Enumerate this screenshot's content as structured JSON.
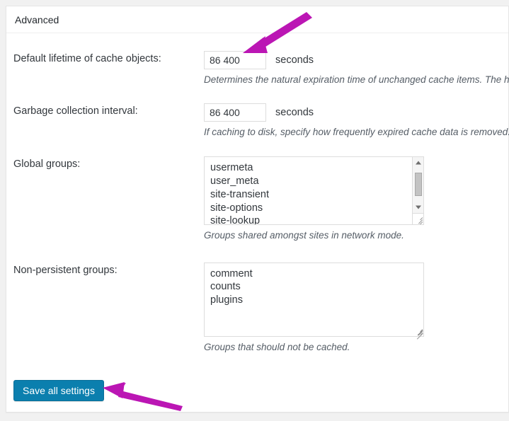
{
  "card": {
    "header_title": "Advanced"
  },
  "fields": {
    "lifetime": {
      "label": "Default lifetime of cache objects:",
      "value": "86 400",
      "placeholder": "",
      "unit": "seconds",
      "description": "Determines the natural expiration time of unchanged cache items. The high"
    },
    "gc_interval": {
      "label": "Garbage collection interval:",
      "value": "86 400",
      "placeholder": "",
      "unit": "seconds",
      "description": "If caching to disk, specify how frequently expired cache data is removed. For"
    },
    "global_groups": {
      "label": "Global groups:",
      "value": "usermeta\nuser_meta\nsite-transient\nsite-options\nsite-lookup\nblog-lookup",
      "visible_lines": [
        "usermeta",
        "user_meta",
        "site-transient",
        "site-options",
        "site-lookup"
      ],
      "description": "Groups shared amongst sites in network mode."
    },
    "nonpersistent_groups": {
      "label": "Non-persistent groups:",
      "value": "comment\ncounts\nplugins",
      "visible_lines": [
        "comment",
        "counts",
        "plugins"
      ],
      "description": "Groups that should not be cached."
    }
  },
  "submit": {
    "save_label": "Save all settings"
  },
  "annotations": {
    "arrow_to_lifetime_input": "magenta-arrow-pointing-down-left-at-cache-lifetime-field",
    "arrow_to_save_button": "magenta-arrow-pointing-left-at-save-all-settings-button"
  },
  "colors": {
    "page_background": "#f1f1f1",
    "card_background": "#ffffff",
    "card_border": "#e5e5e5",
    "label_text": "#32373c",
    "description_text": "#555d66",
    "input_border": "#dddddd",
    "save_button": "#0b7fae",
    "annotation_arrow": "#bb16b4"
  }
}
